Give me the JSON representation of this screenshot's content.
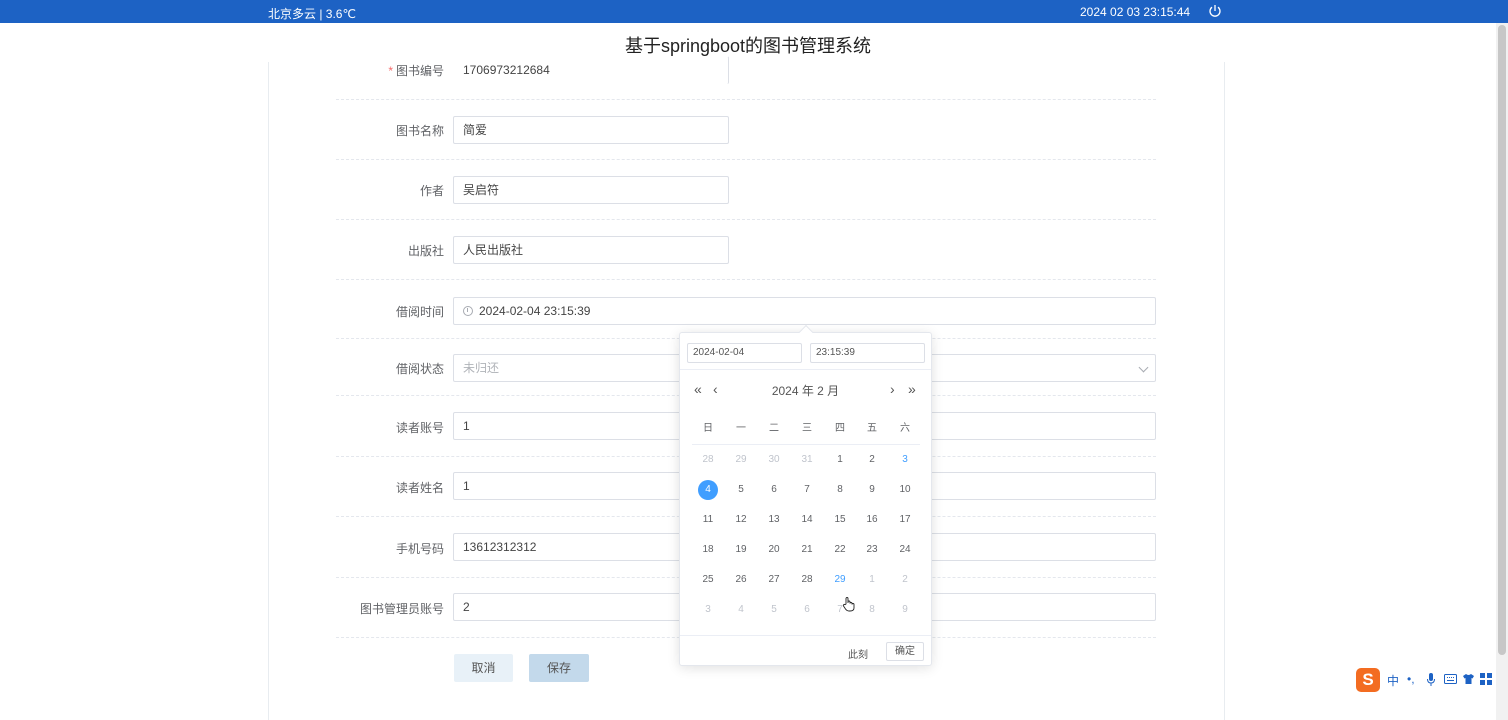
{
  "topbar": {
    "weather": "北京多云 | 3.6℃",
    "datetime": "2024 02 03   23:15:44",
    "power_icon": "power-icon"
  },
  "site_title": "基于springboot的图书管理系统",
  "form": {
    "book_no": {
      "label": "图书编号",
      "required": "*",
      "value": "1706973212684"
    },
    "book_name": {
      "label": "图书名称",
      "value": "简爱"
    },
    "author": {
      "label": "作者",
      "value": "吴启符"
    },
    "publisher": {
      "label": "出版社",
      "value": "人民出版社"
    },
    "borrow_time": {
      "label": "借阅时间",
      "value": "2024-02-04 23:15:39",
      "icon": "clock-icon"
    },
    "borrow_status": {
      "label": "借阅状态",
      "placeholder": "未归还",
      "icon": "chevron-down-icon"
    },
    "reader_account": {
      "label": "读者账号",
      "value": "1"
    },
    "reader_name": {
      "label": "读者姓名",
      "value": "1"
    },
    "phone": {
      "label": "手机号码",
      "value": "13612312312"
    },
    "admin_account": {
      "label": "图书管理员账号",
      "value": "2"
    },
    "cancel_label": "取消",
    "save_label": "保存"
  },
  "picker": {
    "date_value": "2024-02-04",
    "time_value": "23:15:39",
    "header": "2024 年  2 月",
    "prev_year": "«",
    "prev_month": "‹",
    "next_month": "›",
    "next_year": "»",
    "weekdays": [
      "日",
      "一",
      "二",
      "三",
      "四",
      "五",
      "六"
    ],
    "weeks": [
      [
        "28",
        "29",
        "30",
        "31",
        "1",
        "2",
        "3"
      ],
      [
        "4",
        "5",
        "6",
        "7",
        "8",
        "9",
        "10"
      ],
      [
        "11",
        "12",
        "13",
        "14",
        "15",
        "16",
        "17"
      ],
      [
        "18",
        "19",
        "20",
        "21",
        "22",
        "23",
        "24"
      ],
      [
        "25",
        "26",
        "27",
        "28",
        "29",
        "1",
        "2"
      ],
      [
        "3",
        "4",
        "5",
        "6",
        "7",
        "8",
        "9"
      ]
    ],
    "selected_day": "4",
    "highlight_days": [
      "3",
      "29"
    ],
    "now_label": "此刻",
    "ok_label": "确定",
    "accent_color": "#409eff"
  },
  "ime": {
    "logo": "S",
    "mode": "中",
    "punct": "•,",
    "icons": [
      "mic-icon",
      "keyboard-icon",
      "skin-icon",
      "grid-icon"
    ]
  }
}
